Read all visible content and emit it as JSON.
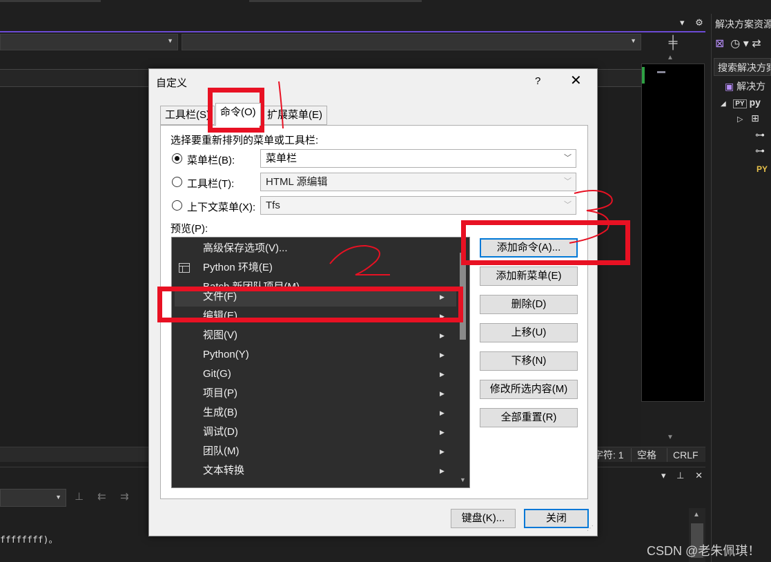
{
  "ide": {
    "status": {
      "char": "字符: 1",
      "space": "空格",
      "crlf": "CRLF"
    },
    "output_text": "ffffffff)。",
    "split_icon": "split-icon"
  },
  "solution_explorer": {
    "title": "解决方案资源",
    "search_placeholder": "搜索解决方案",
    "root_label": "解决方",
    "project_badge": "PY",
    "project_label": "py",
    "file_badge": "PY"
  },
  "dialog": {
    "title": "自定义",
    "help": "?",
    "close": "✕",
    "tabs": [
      {
        "label": "工具栏(S)"
      },
      {
        "label": "命令(O)"
      },
      {
        "label": "扩展菜单(E)"
      }
    ],
    "select_prompt": "选择要重新排列的菜单或工具栏:",
    "options": [
      {
        "label": "菜单栏(B):",
        "value": "菜单栏",
        "checked": true
      },
      {
        "label": "工具栏(T):",
        "value": "HTML 源编辑",
        "checked": false
      },
      {
        "label": "上下文菜单(X):",
        "value": "Tfs",
        "checked": false
      }
    ],
    "preview_label": "预览(P):",
    "preview_items": [
      "高级保存选项(V)...",
      "Python 环境(E)",
      "Batch 新团队项目(M)",
      "文件(F)",
      "编辑(E)",
      "视图(V)",
      "Python(Y)",
      "Git(G)",
      "项目(P)",
      "生成(B)",
      "调试(D)",
      "团队(M)",
      "文本转换"
    ],
    "buttons": {
      "add_command": "添加命令(A)...",
      "add_menu": "添加新菜单(E)",
      "delete": "删除(D)",
      "move_up": "上移(U)",
      "move_down": "下移(N)",
      "modify": "修改所选内容(M)",
      "reset_all": "全部重置(R)",
      "keyboard": "键盘(K)...",
      "close": "关闭"
    }
  },
  "annotations": {
    "color": "#e81123",
    "watermark": "CSDN @老朱佩琪！"
  }
}
